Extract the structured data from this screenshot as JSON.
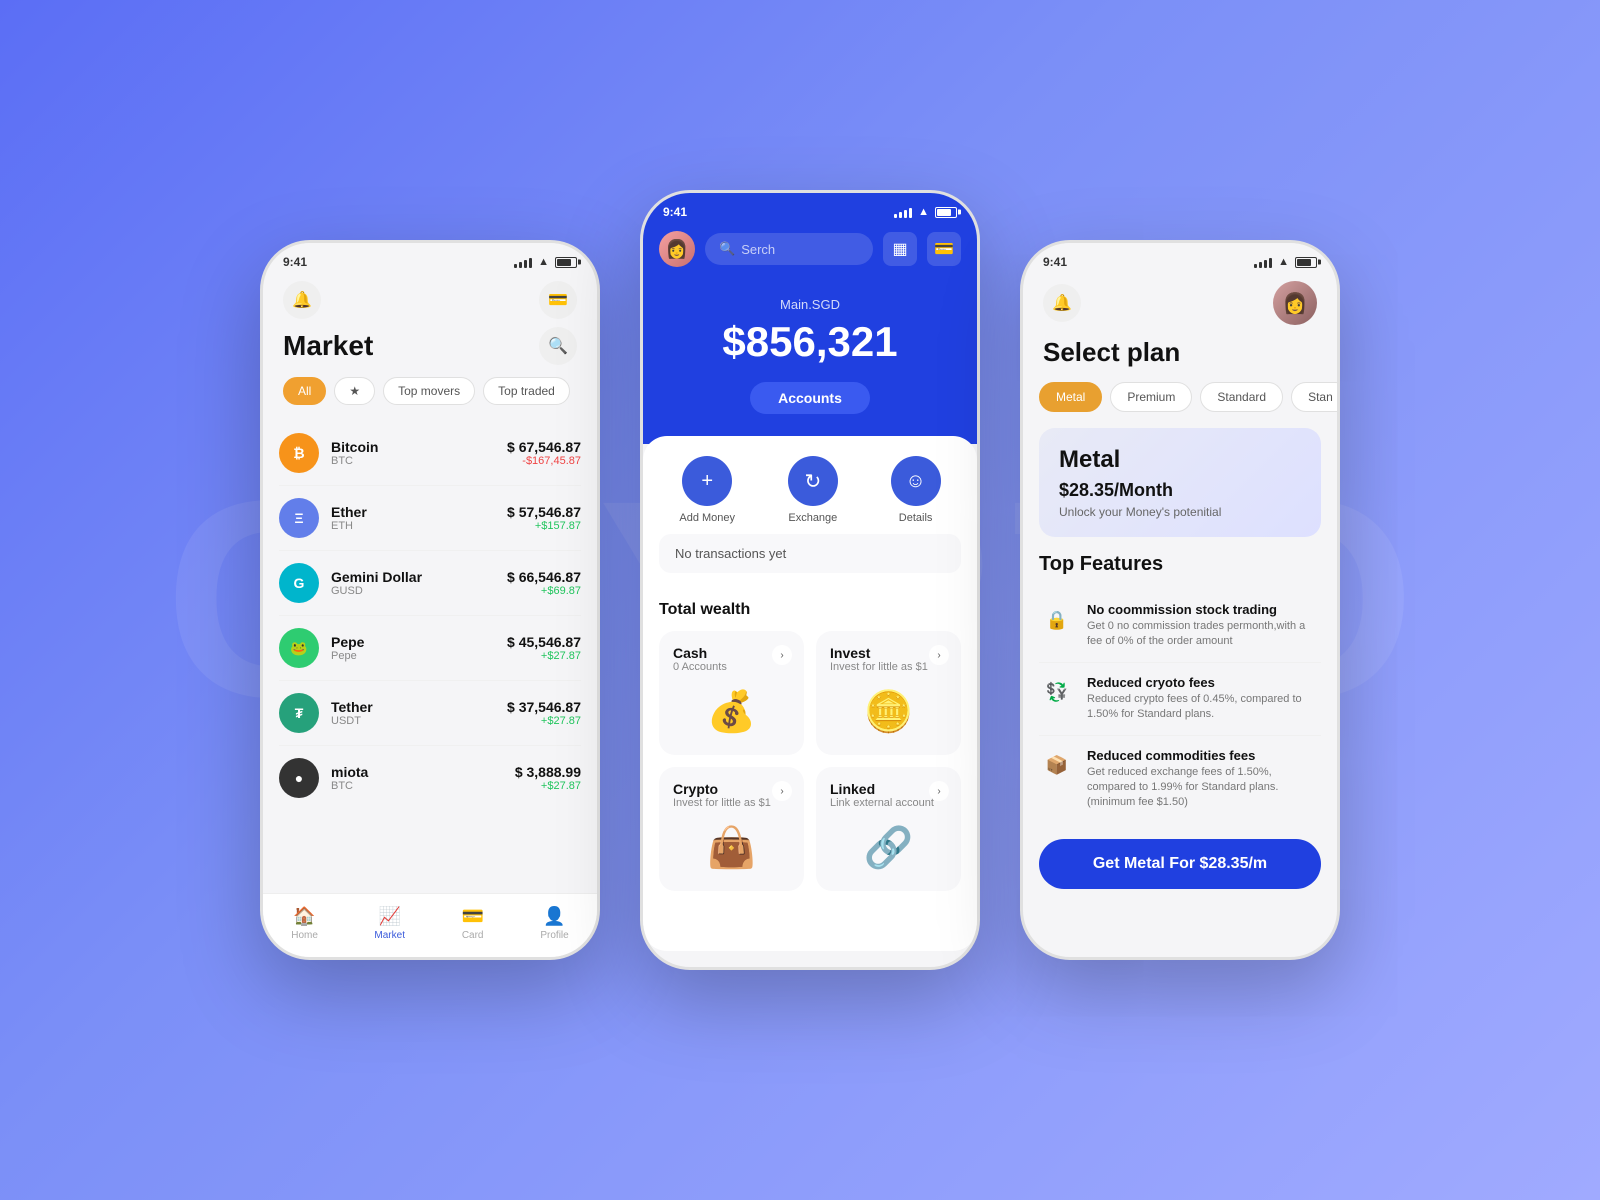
{
  "background": {
    "watermark": "CRYPTO"
  },
  "phone1": {
    "time": "9:41",
    "title": "Market",
    "filters": [
      "All",
      "★",
      "Top movers",
      "Top traded"
    ],
    "active_filter": "All",
    "cryptos": [
      {
        "name": "Bitcoin",
        "symbol": "BTC",
        "price": "$ 67,546.87",
        "change": "-$167,45.87",
        "positive": false,
        "color": "#f7931a",
        "letter": "₿"
      },
      {
        "name": "Ether",
        "symbol": "ETH",
        "price": "$ 57,546.87",
        "change": "+$157.87",
        "positive": true,
        "color": "#627eea",
        "letter": "Ξ"
      },
      {
        "name": "Gemini Dollar",
        "symbol": "GUSD",
        "price": "$ 66,546.87",
        "change": "+$69.87",
        "positive": true,
        "color": "#00dcfa",
        "letter": "G"
      },
      {
        "name": "Pepe",
        "symbol": "Pepe",
        "price": "$ 45,546.87",
        "change": "+$27.87",
        "positive": true,
        "color": "#2ecc71",
        "letter": "🐸"
      },
      {
        "name": "Tether",
        "symbol": "USDT",
        "price": "$ 37,546.87",
        "change": "+$27.87",
        "positive": true,
        "color": "#26a17b",
        "letter": "₮"
      },
      {
        "name": "miota",
        "symbol": "BTC",
        "price": "$ 3,888.99",
        "change": "+$27.87",
        "positive": true,
        "color": "#333",
        "letter": "●"
      }
    ],
    "nav": [
      {
        "label": "Home",
        "icon": "🏠",
        "active": false
      },
      {
        "label": "Market",
        "icon": "📈",
        "active": true
      },
      {
        "label": "Card",
        "icon": "💳",
        "active": false
      },
      {
        "label": "Profile",
        "icon": "👤",
        "active": false
      }
    ]
  },
  "phone2": {
    "time": "9:41",
    "search_placeholder": "Serch",
    "balance_label": "Main.SGD",
    "balance_amount": "$856,321",
    "accounts_btn": "Accounts",
    "actions": [
      {
        "label": "Add Money",
        "icon": "+"
      },
      {
        "label": "Exchange",
        "icon": "↻"
      },
      {
        "label": "Details",
        "icon": "☺"
      }
    ],
    "no_transactions": "No transactions yet",
    "total_wealth_title": "Total wealth",
    "wealth_cards": [
      {
        "title": "Cash",
        "sub": "0 Accounts",
        "emoji": "💰"
      },
      {
        "title": "Invest",
        "sub": "Invest for little as $1",
        "emoji": "🪙"
      },
      {
        "title": "Crypto",
        "sub": "Invest for little as $1",
        "emoji": "👜"
      },
      {
        "title": "Linked",
        "sub": "Link external account",
        "emoji": "🔗"
      }
    ]
  },
  "phone3": {
    "time": "9:41",
    "title": "Select plan",
    "plan_tabs": [
      "Metal",
      "Premium",
      "Standard",
      "Stan"
    ],
    "active_plan": "Metal",
    "selected": {
      "name": "Metal",
      "price": "$28.35/Month",
      "desc": "Unlock your Money's potenitial"
    },
    "features_title": "Top Features",
    "features": [
      {
        "icon": "🔒",
        "title": "No coommission stock trading",
        "desc": "Get 0 no commission trades permonth,with a fee of 0% of the order amount"
      },
      {
        "icon": "💱",
        "title": "Reduced cryoto fees",
        "desc": "Reduced crypto fees of 0.45%, compared to 1.50% for Standard plans."
      },
      {
        "icon": "📦",
        "title": "Reduced commodities fees",
        "desc": "Get reduced exchange fees of 1.50%, compared to 1.99% for Standard plans. (minimum fee $1.50)"
      }
    ],
    "cta_label": "Get Metal  For $28.35/m"
  }
}
